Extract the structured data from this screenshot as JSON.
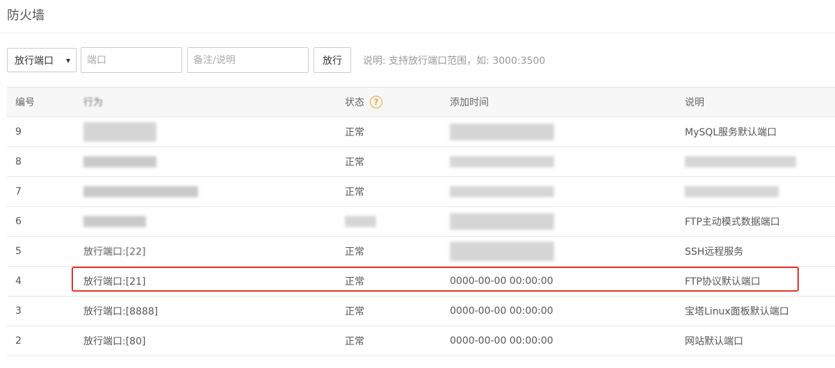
{
  "page_title": "防火墙",
  "toolbar": {
    "select_value": "放行端口",
    "port_placeholder": "端口",
    "note_placeholder": "备注/说明",
    "submit_label": "放行",
    "hint": "说明: 支持放行端口范围，如: 3000:3500"
  },
  "table": {
    "headers": {
      "id": "编号",
      "action": "行为",
      "status": "状态",
      "time": "添加时间",
      "desc": "说明"
    },
    "rows": [
      {
        "id": "9",
        "action": "",
        "status": "正常",
        "time": "",
        "desc": "MySQL服务默认端口"
      },
      {
        "id": "8",
        "action": "",
        "status": "正常",
        "time": "",
        "desc": ""
      },
      {
        "id": "7",
        "action": "",
        "status": "正常",
        "time": "",
        "desc": ""
      },
      {
        "id": "6",
        "action": "",
        "status": "",
        "time": "",
        "desc": "FTP主动模式数据端口"
      },
      {
        "id": "5",
        "action": "放行端口:[22]",
        "status": "正常",
        "time": "",
        "desc": "SSH远程服务"
      },
      {
        "id": "4",
        "action": "放行端口:[21]",
        "status": "正常",
        "time": "0000-00-00 00:00:00",
        "desc": "FTP协议默认端口"
      },
      {
        "id": "3",
        "action": "放行端口:[8888]",
        "status": "正常",
        "time": "0000-00-00 00:00:00",
        "desc": "宝塔Linux面板默认端口"
      },
      {
        "id": "2",
        "action": "放行端口:[80]",
        "status": "正常",
        "time": "0000-00-00 00:00:00",
        "desc": "网站默认端口"
      }
    ]
  },
  "colors": {
    "highlight": "#e0302b",
    "help_icon": "#e9a23b"
  },
  "icons": {
    "select_chevron": "chevron-down-icon",
    "status_help": "question-circle-icon"
  }
}
